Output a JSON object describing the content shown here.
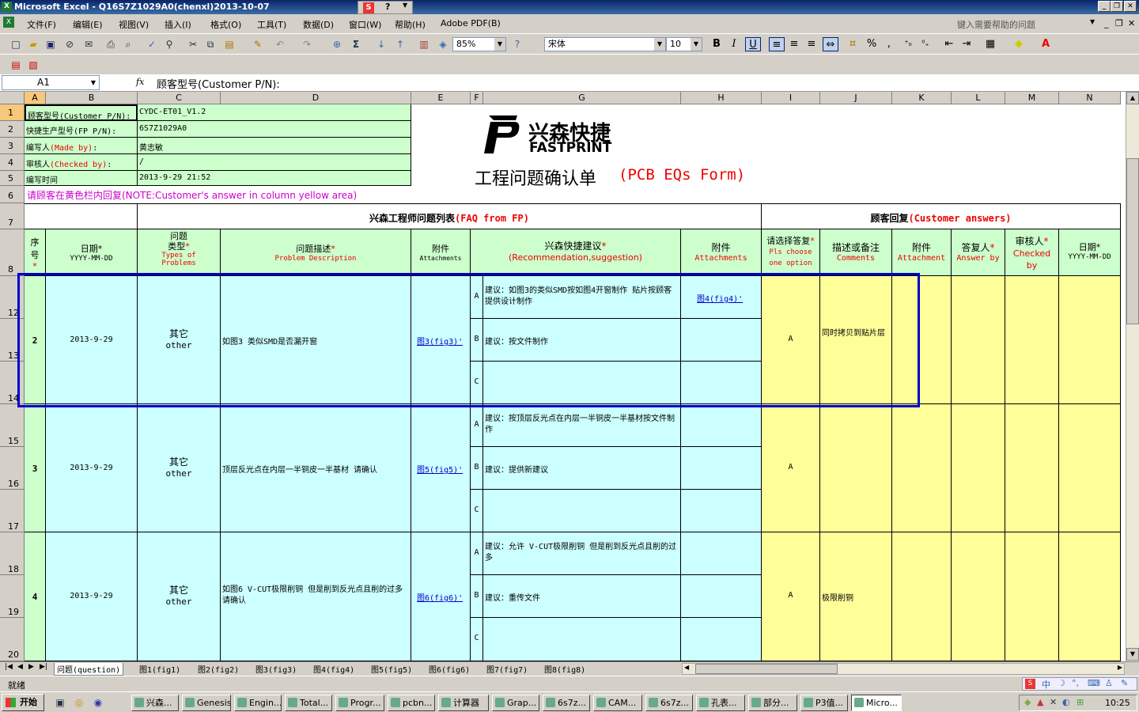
{
  "window": {
    "title": "Microsoft Excel - Q16S7Z1029A0(chenxl)2013-10-07",
    "min": "_",
    "max": "❐",
    "close": "✕"
  },
  "menu": [
    "文件(F)",
    "编辑(E)",
    "视图(V)",
    "插入(I)",
    "格式(O)",
    "工具(T)",
    "数据(D)",
    "窗口(W)",
    "帮助(H)",
    "Adobe PDF(B)"
  ],
  "help_placeholder": "键入需要帮助的问题",
  "toolbar": {
    "zoom": "85%",
    "font": "宋体",
    "size": "10",
    "bold": "B",
    "italic": "I",
    "underline": "U",
    "percent": "%",
    "comma": ","
  },
  "namebox": "A1",
  "fx": "fx",
  "formula": "顾客型号(Customer P/N):",
  "columns": [
    "A",
    "B",
    "C",
    "D",
    "E",
    "F",
    "G",
    "H",
    "I",
    "J",
    "K",
    "L",
    "M",
    "N"
  ],
  "rows": [
    "1",
    "2",
    "3",
    "4",
    "5",
    "6",
    "7",
    "8",
    "12",
    "13",
    "14",
    "15",
    "16",
    "17",
    "18",
    "19",
    "20"
  ],
  "info": [
    {
      "label": "顾客型号(Customer P/N):",
      "value": "CYDC-ET01_V1.2"
    },
    {
      "label": "快捷生产型号(FP P/N):",
      "value": "6S7Z1029A0"
    },
    {
      "label": "编写人",
      "label_en": "(Made by)",
      "colon": ":",
      "value": "黄志敏"
    },
    {
      "label": "审核人",
      "label_en": "(Checked by)",
      "colon": ":",
      "value": "/"
    },
    {
      "label": "编写时间",
      "value": "2013-9-29 21:52"
    }
  ],
  "note": "请顾客在黄色栏内回复(NOTE:Customer's answer in column yellow area)",
  "logo": {
    "cn": "兴森快捷",
    "en": "FASTPRINT"
  },
  "form_title": {
    "cn": "工程问题确认单",
    "en": "(PCB EQs Form)"
  },
  "section": {
    "fp_cn": "兴森工程师问题列表",
    "fp_en": "(FAQ from FP)",
    "cust_cn": "顾客回复",
    "cust_en": "(Customer answers)"
  },
  "headers": {
    "seq": "序号",
    "date": "日期",
    "date_fmt": "YYYY-MM-DD",
    "type": "问题类型",
    "type_en": "Types of Problems",
    "desc": "问题描述",
    "desc_en": "Problem Description",
    "att": "附件",
    "att_en": "Attachments",
    "rec": "兴森快捷建议",
    "rec_en": "(Recommendation,suggestion)",
    "att2": "附件",
    "att2_en": "Attachments",
    "choose": "请选择答复",
    "choose_en": "Pls choose one option",
    "comments": "描述或备注",
    "comments_en": "Comments",
    "att3": "附件",
    "att3_en": "Attachment",
    "answer": "答复人",
    "answer_en": "Answer by",
    "checked": "审核人",
    "checked_en": "Checked by",
    "date2": "日期",
    "date2_fmt": "YYYY-MM-DD",
    "star": "*"
  },
  "issues": [
    {
      "seq": "2",
      "date": "2013-9-29",
      "type": "其它",
      "type_en": "other",
      "desc": "如图3 类似SMD是否漏开窗",
      "att": "图3(fig3)'",
      "options": [
        {
          "k": "A",
          "t": "建议：如图3的类似SMD按如图4开窗制作 贴片按顾客提供设计制作",
          "att": "图4(fig4)'"
        },
        {
          "k": "B",
          "t": "建议：按文件制作",
          "att": ""
        },
        {
          "k": "C",
          "t": "",
          "att": ""
        }
      ],
      "choice": "A",
      "comment": "同时拷贝到贴片层"
    },
    {
      "seq": "3",
      "date": "2013-9-29",
      "type": "其它",
      "type_en": "other",
      "desc": "顶层反光点在内层一半铜皮一半基材 请确认",
      "att": "图5(fig5)'",
      "options": [
        {
          "k": "A",
          "t": "建议：按顶层反光点在内层一半铜皮一半基材按文件制作",
          "att": ""
        },
        {
          "k": "B",
          "t": "建议：提供新建议",
          "att": ""
        },
        {
          "k": "C",
          "t": "",
          "att": ""
        }
      ],
      "choice": "A",
      "comment": ""
    },
    {
      "seq": "4",
      "date": "2013-9-29",
      "type": "其它",
      "type_en": "other",
      "desc": "如图6 V-CUT极限削铜 但是削到反光点且削的过多 请确认",
      "att": "图6(fig6)'",
      "options": [
        {
          "k": "A",
          "t": "建议：允许 V-CUT极限削铜 但是削到反光点且削的过多",
          "att": ""
        },
        {
          "k": "B",
          "t": "建议：重传文件",
          "att": ""
        },
        {
          "k": "C",
          "t": "",
          "att": ""
        }
      ],
      "choice": "A",
      "comment": "极限削铜"
    }
  ],
  "sheet_tabs": [
    "问题(question)",
    "图1(fig1)",
    "图2(fig2)",
    "图3(fig3)",
    "图4(fig4)",
    "图5(fig5)",
    "图6(fig6)",
    "图7(fig7)",
    "图8(fig8)"
  ],
  "status": "就绪",
  "start": "开始",
  "tasks": [
    "兴森...",
    "Genesis",
    "Engin...",
    "Total...",
    "Progr...",
    "pcbn...",
    "计算器",
    "Grap...",
    "6s7z...",
    "CAM...",
    "6s7z...",
    "孔表...",
    "部分...",
    "P3值...",
    "Micro..."
  ],
  "clock": "10:25",
  "colors": {
    "highlight": "#0000cc",
    "yellow": "#ffff99",
    "cyan": "#ccffff",
    "green": "#ccffcc"
  }
}
